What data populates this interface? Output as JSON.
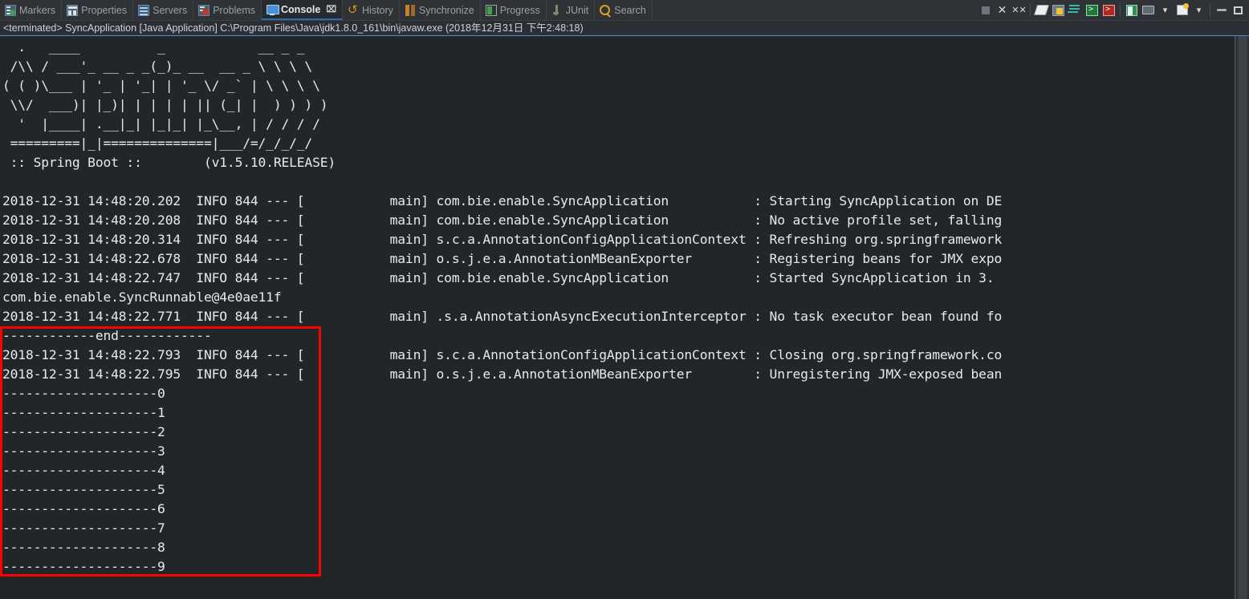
{
  "window": {
    "title": "Console"
  },
  "tabs": [
    {
      "label": "Markers",
      "icon": "markers-icon",
      "active": false,
      "closable": false
    },
    {
      "label": "Properties",
      "icon": "properties-icon",
      "active": false,
      "closable": false
    },
    {
      "label": "Servers",
      "icon": "servers-icon",
      "active": false,
      "closable": false
    },
    {
      "label": "Problems",
      "icon": "problems-icon",
      "active": false,
      "closable": false
    },
    {
      "label": "Console",
      "icon": "console-icon",
      "active": true,
      "closable": true,
      "close_glyph": "⌧"
    },
    {
      "label": "History",
      "icon": "history-icon",
      "active": false,
      "closable": false
    },
    {
      "label": "Synchronize",
      "icon": "synchronize-icon",
      "active": false,
      "closable": false
    },
    {
      "label": "Progress",
      "icon": "progress-icon",
      "active": false,
      "closable": false
    },
    {
      "label": "JUnit",
      "icon": "junit-icon",
      "active": false,
      "closable": false
    },
    {
      "label": "Search",
      "icon": "search-icon",
      "active": false,
      "closable": false
    }
  ],
  "toolbar": {
    "buttons": [
      {
        "name": "terminate-button",
        "icon": "stop-square-icon",
        "tooltip": "Terminate"
      },
      {
        "name": "remove-launch-button",
        "icon": "close-x-icon",
        "tooltip": "Remove Launch"
      },
      {
        "name": "remove-all-terminated-button",
        "icon": "close-all-xx-icon",
        "tooltip": "Remove All Terminated Launches"
      },
      {
        "name": "clear-console-button",
        "icon": "clear-console-icon",
        "tooltip": "Clear Console"
      },
      {
        "name": "scroll-lock-button",
        "icon": "scroll-lock-icon",
        "tooltip": "Scroll Lock"
      },
      {
        "name": "word-wrap-button",
        "icon": "word-wrap-icon",
        "tooltip": "Word Wrap"
      },
      {
        "name": "show-console-stdout-button",
        "icon": "console-stdout-icon",
        "tooltip": "Show Console When Standard Out Changes"
      },
      {
        "name": "show-console-stderr-button",
        "icon": "console-stderr-icon",
        "tooltip": "Show Console When Standard Error Changes"
      },
      {
        "name": "pin-console-button",
        "icon": "pin-console-icon",
        "tooltip": "Pin Console"
      },
      {
        "name": "display-selected-console-button",
        "icon": "display-console-icon",
        "tooltip": "Display Selected Console"
      },
      {
        "name": "display-console-dropdown",
        "icon": "chevron-down-icon",
        "tooltip": "Display Selected Console menu"
      },
      {
        "name": "open-console-button",
        "icon": "new-console-icon",
        "tooltip": "Open Console"
      },
      {
        "name": "open-console-dropdown",
        "icon": "chevron-down-icon",
        "tooltip": "Open Console menu"
      },
      {
        "name": "minimize-view-button",
        "icon": "minimize-icon",
        "tooltip": "Minimize"
      },
      {
        "name": "maximize-view-button",
        "icon": "maximize-icon",
        "tooltip": "Maximize"
      }
    ]
  },
  "process_line": "<terminated> SyncApplication [Java Application] C:\\Program Files\\Java\\jdk1.8.0_161\\bin\\javaw.exe (2018年12月31日 下午2:48:18)",
  "console": {
    "banner": "  .   ____          _            __ _ _\n /\\\\ / ___'_ __ _ _(_)_ __  __ _ \\ \\ \\ \\\n( ( )\\___ | '_ | '_| | '_ \\/ _` | \\ \\ \\ \\\n \\\\/  ___)| |_)| | | | | || (_| |  ) ) ) )\n  '  |____| .__|_| |_|_| |_\\__, | / / / /\n =========|_|==============|___/=/_/_/_/\n :: Spring Boot ::        (v1.5.10.RELEASE)",
    "log_lines": [
      "2018-12-31 14:48:20.202  INFO 844 --- [           main] com.bie.enable.SyncApplication           : Starting SyncApplication on DE",
      "2018-12-31 14:48:20.208  INFO 844 --- [           main] com.bie.enable.SyncApplication           : No active profile set, falling",
      "2018-12-31 14:48:20.314  INFO 844 --- [           main] s.c.a.AnnotationConfigApplicationContext : Refreshing org.springframework",
      "2018-12-31 14:48:22.678  INFO 844 --- [           main] o.s.j.e.a.AnnotationMBeanExporter        : Registering beans for JMX expo",
      "2018-12-31 14:48:22.747  INFO 844 --- [           main] com.bie.enable.SyncApplication           : Started SyncApplication in 3.",
      "com.bie.enable.SyncRunnable@4e0ae11f",
      "2018-12-31 14:48:22.771  INFO 844 --- [           main] .s.a.AnnotationAsyncExecutionInterceptor : No task executor bean found fo",
      "------------end------------",
      "2018-12-31 14:48:22.793  INFO 844 --- [           main] s.c.a.AnnotationConfigApplicationContext : Closing org.springframework.co",
      "2018-12-31 14:48:22.795  INFO 844 --- [           main] o.s.j.e.a.AnnotationMBeanExporter        : Unregistering JMX-exposed bean",
      "--------------------0",
      "--------------------1",
      "--------------------2",
      "--------------------3",
      "--------------------4",
      "--------------------5",
      "--------------------6",
      "--------------------7",
      "--------------------8",
      "--------------------9"
    ]
  },
  "annotation": {
    "highlight_color": "#ff0000",
    "highlight_label": "end-and-counter-output-highlight"
  },
  "colors": {
    "background": "#232629",
    "tabbar": "#2f3337",
    "text": "#e7eaec",
    "accent": "#4a90d9",
    "inactive_tab_text": "#9aa0a6"
  }
}
